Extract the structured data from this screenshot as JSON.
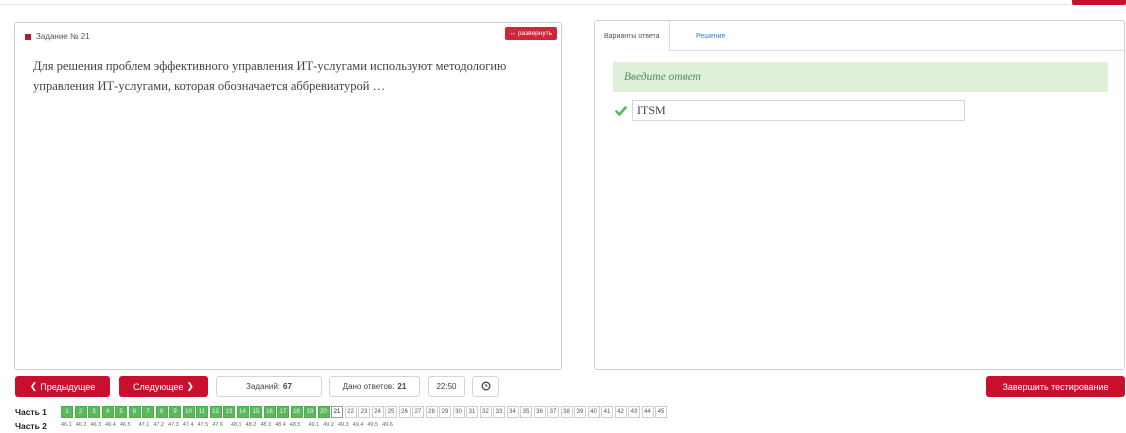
{
  "task": {
    "header": "Задание № 21",
    "expand_label": "развернуть",
    "question": "Для решения проблем эффективного управления ИТ-услугами используют методологию управления ИТ-услугами, которая обозначается аббревиатурой …"
  },
  "answer_panel": {
    "tabs": [
      "Варианты ответа",
      "Решение"
    ],
    "prompt": "Введите ответ",
    "value": "ITSM"
  },
  "toolbar": {
    "prev_label": "Предыдущее",
    "next_label": "Следующее",
    "tasks_label": "Заданий:",
    "tasks_count": "67",
    "answered_label": "Дано ответов:",
    "answered_count": "21",
    "timer": "22:50",
    "finish_label": "Завершить тестирование"
  },
  "parts": {
    "part1_label": "Часть 1",
    "part1_items": [
      "1",
      "2",
      "3",
      "4",
      "5",
      "6",
      "7",
      "8",
      "9",
      "10",
      "11",
      "12",
      "13",
      "14",
      "15",
      "16",
      "17",
      "18",
      "19",
      "20",
      "21",
      "22",
      "23",
      "24",
      "25",
      "26",
      "27",
      "28",
      "29",
      "30",
      "31",
      "32",
      "33",
      "34",
      "35",
      "36",
      "37",
      "38",
      "39",
      "40",
      "41",
      "42",
      "43",
      "44",
      "45"
    ],
    "part1_done_count": 20,
    "part1_current": "21",
    "part2_label": "Часть 2",
    "part2_items": [
      "46.1",
      "46.2",
      "46.3",
      "46.4",
      "46.5",
      "47.1",
      "47.2",
      "47.3",
      "47.4",
      "47.5",
      "47.6",
      "48.1",
      "48.2",
      "48.3",
      "48.4",
      "48.5",
      "49.1",
      "49.2",
      "49.3",
      "49.4",
      "49.5",
      "49.6"
    ]
  },
  "colors": {
    "accent_red": "#c8102e",
    "done_green": "#5cb85c",
    "banner_green": "#dff0d8",
    "link_blue": "#3a7bc8"
  }
}
